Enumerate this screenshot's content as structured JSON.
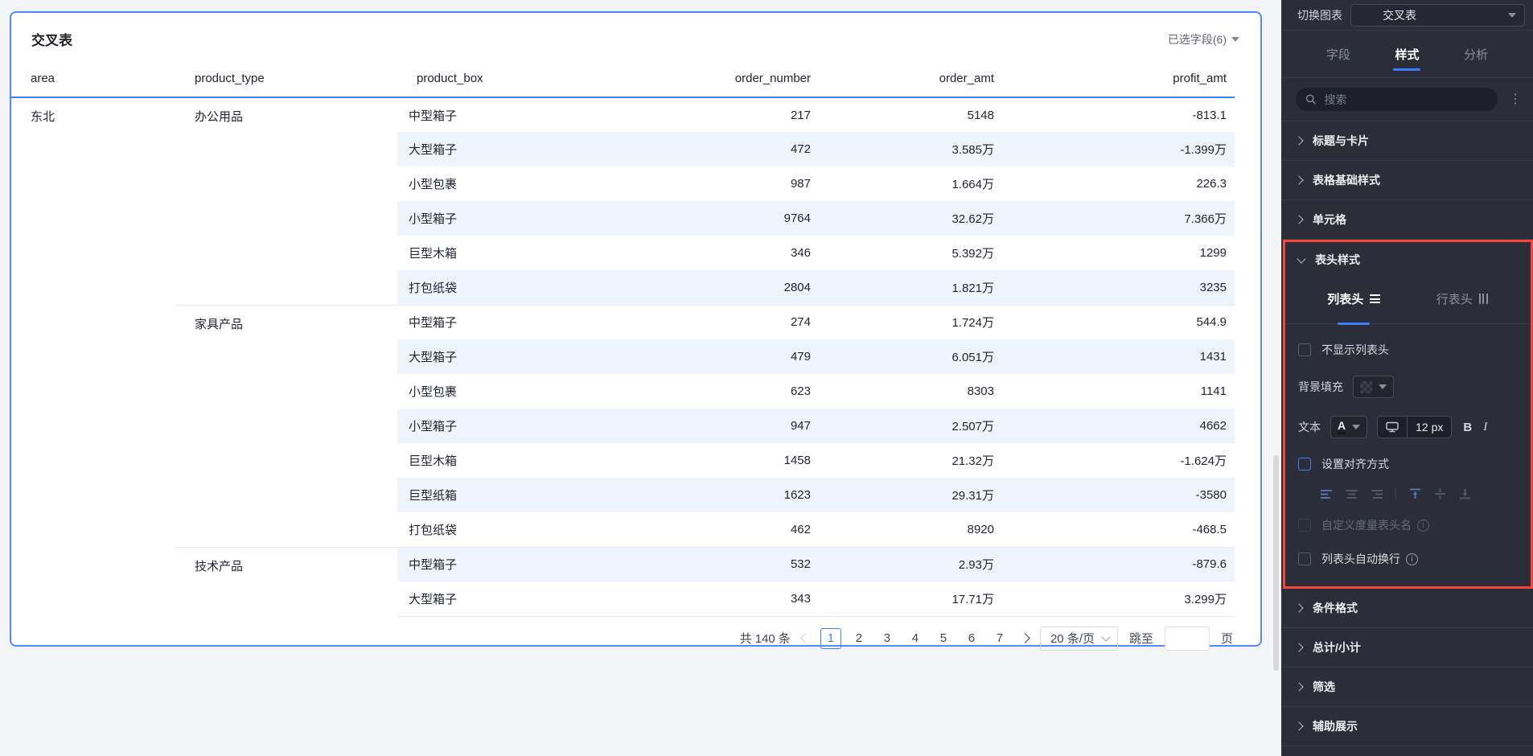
{
  "card": {
    "title": "交叉表",
    "selected_fields": "已选字段(6)",
    "pagination": {
      "total": "共 140 条",
      "pages": [
        "1",
        "2",
        "3",
        "4",
        "5",
        "6",
        "7"
      ],
      "current": "1",
      "page_size": "20 条/页",
      "jump_label": "跳至",
      "page_unit": "页"
    }
  },
  "chart_data": {
    "type": "table",
    "columns": [
      "area",
      "product_type",
      "product_box",
      "order_number",
      "order_amt",
      "profit_amt"
    ],
    "area": "东北",
    "groups": [
      {
        "product_type": "办公用品",
        "rows": [
          [
            "中型箱子",
            "217",
            "5148",
            "-813.1"
          ],
          [
            "大型箱子",
            "472",
            "3.585万",
            "-1.399万"
          ],
          [
            "小型包裹",
            "987",
            "1.664万",
            "226.3"
          ],
          [
            "小型箱子",
            "9764",
            "32.62万",
            "7.366万"
          ],
          [
            "巨型木箱",
            "346",
            "5.392万",
            "1299"
          ],
          [
            "打包纸袋",
            "2804",
            "1.821万",
            "3235"
          ]
        ]
      },
      {
        "product_type": "家具产品",
        "rows": [
          [
            "中型箱子",
            "274",
            "1.724万",
            "544.9"
          ],
          [
            "大型箱子",
            "479",
            "6.051万",
            "1431"
          ],
          [
            "小型包裹",
            "623",
            "8303",
            "1141"
          ],
          [
            "小型箱子",
            "947",
            "2.507万",
            "4662"
          ],
          [
            "巨型木箱",
            "1458",
            "21.32万",
            "-1.624万"
          ],
          [
            "巨型纸箱",
            "1623",
            "29.31万",
            "-3580"
          ],
          [
            "打包纸袋",
            "462",
            "8920",
            "-468.5"
          ]
        ]
      },
      {
        "product_type": "技术产品",
        "rows": [
          [
            "中型箱子",
            "532",
            "2.93万",
            "-879.6"
          ],
          [
            "大型箱子",
            "343",
            "17.71万",
            "3.299万"
          ]
        ]
      }
    ]
  },
  "panel": {
    "switch_label": "切换图表",
    "chart_type": "交叉表",
    "tabs": [
      {
        "label": "字段"
      },
      {
        "label": "样式"
      },
      {
        "label": "分析"
      }
    ],
    "search_placeholder": "搜索",
    "sections_top": [
      "标题与卡片",
      "表格基础样式",
      "单元格"
    ],
    "header_style": {
      "title": "表头样式",
      "tab_col": "列表头",
      "tab_row": "行表头",
      "hide_col_header": "不显示列表头",
      "bg_fill_label": "背景填充",
      "text_label": "文本",
      "color_letter": "A",
      "font_size": "12 px",
      "bold_label": "B",
      "italic_label": "I",
      "set_align": "设置对齐方式",
      "custom_measure": "自定义度量表头名",
      "auto_wrap": "列表头自动换行"
    },
    "sections_bottom": [
      "条件格式",
      "总计/小计",
      "筛选",
      "辅助展示"
    ]
  },
  "colors": {
    "accent_blue": "#3d7eff",
    "card_border_blue": "#4f8bff",
    "highlight_red": "#f5483b",
    "row_stripe": "#eef4fd",
    "panel_bg": "#2b2e38"
  }
}
